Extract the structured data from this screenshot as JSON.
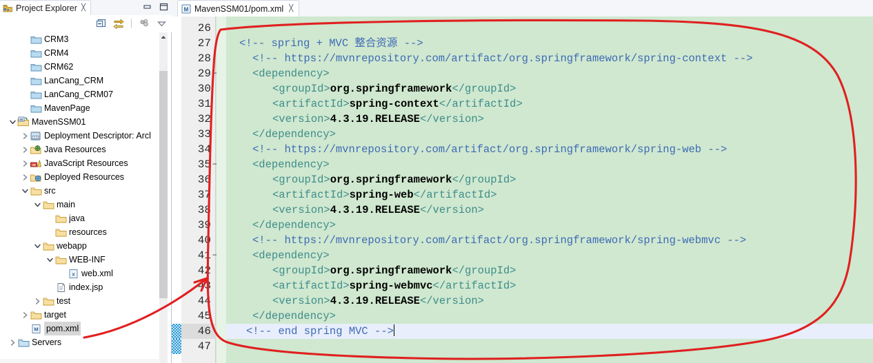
{
  "window": {
    "minimize_label": "Minimize",
    "maximize_label": "Maximize"
  },
  "project_explorer": {
    "title": "Project Explorer",
    "close_glyph": "╳",
    "icon": "project-explorer-icon",
    "toolbar": [
      {
        "name": "collapse-all-icon",
        "tooltip": "Collapse All"
      },
      {
        "name": "link-with-editor-icon",
        "tooltip": "Link with Editor"
      },
      {
        "name": "view-menu-dots-icon",
        "tooltip": "View Menu"
      },
      {
        "name": "view-menu-chevron-icon",
        "tooltip": "View Menu"
      }
    ],
    "scroll_up_glyph": "▲",
    "tree": [
      {
        "label": "CRM3",
        "indent": 1,
        "twisty": "",
        "icon": "folder-blue-icon",
        "selected": false
      },
      {
        "label": "CRM4",
        "indent": 1,
        "twisty": "",
        "icon": "folder-blue-icon",
        "selected": false
      },
      {
        "label": "CRM62",
        "indent": 1,
        "twisty": "",
        "icon": "folder-blue-icon",
        "selected": false
      },
      {
        "label": "LanCang_CRM",
        "indent": 1,
        "twisty": "",
        "icon": "folder-blue-icon",
        "selected": false
      },
      {
        "label": "LanCang_CRM07",
        "indent": 1,
        "twisty": "",
        "icon": "folder-blue-icon",
        "selected": false
      },
      {
        "label": "MavenPage",
        "indent": 1,
        "twisty": "",
        "icon": "folder-blue-icon",
        "selected": false
      },
      {
        "label": "MavenSSM01",
        "indent": 0,
        "twisty": "open",
        "icon": "maven-project-icon",
        "selected": false
      },
      {
        "label": "Deployment Descriptor: Arcl",
        "indent": 1,
        "twisty": "closed",
        "icon": "deployment-descriptor-icon",
        "selected": false
      },
      {
        "label": "Java Resources",
        "indent": 1,
        "twisty": "closed",
        "icon": "java-resources-icon",
        "selected": false
      },
      {
        "label": "JavaScript Resources",
        "indent": 1,
        "twisty": "closed",
        "icon": "javascript-resources-icon",
        "selected": false
      },
      {
        "label": "Deployed Resources",
        "indent": 1,
        "twisty": "closed",
        "icon": "deployed-resources-icon",
        "selected": false
      },
      {
        "label": "src",
        "indent": 1,
        "twisty": "open",
        "icon": "folder-tan-icon",
        "selected": false
      },
      {
        "label": "main",
        "indent": 2,
        "twisty": "open",
        "icon": "folder-tan-icon",
        "selected": false
      },
      {
        "label": "java",
        "indent": 3,
        "twisty": "",
        "icon": "folder-tan-icon",
        "selected": false
      },
      {
        "label": "resources",
        "indent": 3,
        "twisty": "",
        "icon": "folder-tan-icon",
        "selected": false
      },
      {
        "label": "webapp",
        "indent": 2,
        "twisty": "open",
        "icon": "folder-tan-icon",
        "selected": false
      },
      {
        "label": "WEB-INF",
        "indent": 3,
        "twisty": "open",
        "icon": "folder-tan-icon",
        "selected": false
      },
      {
        "label": "web.xml",
        "indent": 4,
        "twisty": "",
        "icon": "xml-file-icon",
        "selected": false
      },
      {
        "label": "index.jsp",
        "indent": 3,
        "twisty": "",
        "icon": "jsp-file-icon",
        "selected": false
      },
      {
        "label": "test",
        "indent": 2,
        "twisty": "closed",
        "icon": "folder-tan-icon",
        "selected": false
      },
      {
        "label": "target",
        "indent": 1,
        "twisty": "closed",
        "icon": "folder-tan-icon",
        "selected": false
      },
      {
        "label": "pom.xml",
        "indent": 1,
        "twisty": "",
        "icon": "maven-pom-icon",
        "selected": true
      },
      {
        "label": "Servers",
        "indent": 0,
        "twisty": "closed",
        "icon": "servers-folder-icon",
        "selected": false
      }
    ]
  },
  "editor": {
    "tab": {
      "label": "MavenSSM01/pom.xml",
      "icon": "maven-pom-icon",
      "close_glyph": "╳"
    },
    "first_line_number": 26,
    "current_line": 46,
    "folded_lines": [
      29,
      35,
      41
    ],
    "marker_lines": [
      46,
      47
    ],
    "lines": [
      {
        "n": 26,
        "indent": 0,
        "segments": []
      },
      {
        "n": 27,
        "indent": 2,
        "segments": [
          {
            "cls": "cmt",
            "t": "<!-- spring + MVC 整合资源 -->"
          }
        ]
      },
      {
        "n": 28,
        "indent": 4,
        "segments": [
          {
            "cls": "cmt",
            "t": "<!-- https://mvnrepository.com/artifact/org.springframework/spring-context -->"
          }
        ]
      },
      {
        "n": 29,
        "indent": 4,
        "segments": [
          {
            "cls": "tag",
            "t": "<dependency>"
          }
        ]
      },
      {
        "n": 30,
        "indent": 7,
        "segments": [
          {
            "cls": "tag",
            "t": "<groupId>"
          },
          {
            "cls": "txt",
            "t": "org.springframework"
          },
          {
            "cls": "tag",
            "t": "</groupId>"
          }
        ]
      },
      {
        "n": 31,
        "indent": 7,
        "segments": [
          {
            "cls": "tag",
            "t": "<artifactId>"
          },
          {
            "cls": "txt",
            "t": "spring-context"
          },
          {
            "cls": "tag",
            "t": "</artifactId>"
          }
        ]
      },
      {
        "n": 32,
        "indent": 7,
        "segments": [
          {
            "cls": "tag",
            "t": "<version>"
          },
          {
            "cls": "txt",
            "t": "4.3.19.RELEASE"
          },
          {
            "cls": "tag",
            "t": "</version>"
          }
        ]
      },
      {
        "n": 33,
        "indent": 4,
        "segments": [
          {
            "cls": "tag",
            "t": "</dependency>"
          }
        ]
      },
      {
        "n": 34,
        "indent": 4,
        "segments": [
          {
            "cls": "cmt",
            "t": "<!-- https://mvnrepository.com/artifact/org.springframework/spring-web -->"
          }
        ]
      },
      {
        "n": 35,
        "indent": 4,
        "segments": [
          {
            "cls": "tag",
            "t": "<dependency>"
          }
        ]
      },
      {
        "n": 36,
        "indent": 7,
        "segments": [
          {
            "cls": "tag",
            "t": "<groupId>"
          },
          {
            "cls": "txt",
            "t": "org.springframework"
          },
          {
            "cls": "tag",
            "t": "</groupId>"
          }
        ]
      },
      {
        "n": 37,
        "indent": 7,
        "segments": [
          {
            "cls": "tag",
            "t": "<artifactId>"
          },
          {
            "cls": "txt",
            "t": "spring-web"
          },
          {
            "cls": "tag",
            "t": "</artifactId>"
          }
        ]
      },
      {
        "n": 38,
        "indent": 7,
        "segments": [
          {
            "cls": "tag",
            "t": "<version>"
          },
          {
            "cls": "txt",
            "t": "4.3.19.RELEASE"
          },
          {
            "cls": "tag",
            "t": "</version>"
          }
        ]
      },
      {
        "n": 39,
        "indent": 4,
        "segments": [
          {
            "cls": "tag",
            "t": "</dependency>"
          }
        ]
      },
      {
        "n": 40,
        "indent": 4,
        "segments": [
          {
            "cls": "cmt",
            "t": "<!-- https://mvnrepository.com/artifact/org.springframework/spring-webmvc -->"
          }
        ]
      },
      {
        "n": 41,
        "indent": 4,
        "segments": [
          {
            "cls": "tag",
            "t": "<dependency>"
          }
        ]
      },
      {
        "n": 42,
        "indent": 7,
        "segments": [
          {
            "cls": "tag",
            "t": "<groupId>"
          },
          {
            "cls": "txt",
            "t": "org.springframework"
          },
          {
            "cls": "tag",
            "t": "</groupId>"
          }
        ]
      },
      {
        "n": 43,
        "indent": 7,
        "segments": [
          {
            "cls": "tag",
            "t": "<artifactId>"
          },
          {
            "cls": "txt",
            "t": "spring-webmvc"
          },
          {
            "cls": "tag",
            "t": "</artifactId>"
          }
        ]
      },
      {
        "n": 44,
        "indent": 7,
        "segments": [
          {
            "cls": "tag",
            "t": "<version>"
          },
          {
            "cls": "txt",
            "t": "4.3.19.RELEASE"
          },
          {
            "cls": "tag",
            "t": "</version>"
          }
        ]
      },
      {
        "n": 45,
        "indent": 4,
        "segments": [
          {
            "cls": "tag",
            "t": "</dependency>"
          }
        ]
      },
      {
        "n": 46,
        "indent": 3,
        "segments": [
          {
            "cls": "cmt",
            "t": "<!-- end spring MVC -->"
          },
          {
            "cls": "caret",
            "t": ""
          }
        ]
      },
      {
        "n": 47,
        "indent": 0,
        "segments": []
      }
    ]
  },
  "colors": {
    "code_background": "#cfe8cf",
    "comment": "#3f6ab5",
    "tag": "#3f8c8c",
    "text": "#000000",
    "current_line": "#e8eefb",
    "annotation": "#e02020",
    "gutter": "#efefef"
  },
  "annotation": {
    "name": "red-highlight-ellipse",
    "description": "hand-drawn red loop around the spring MVC dependency block with an arrow pointing to pom.xml"
  }
}
